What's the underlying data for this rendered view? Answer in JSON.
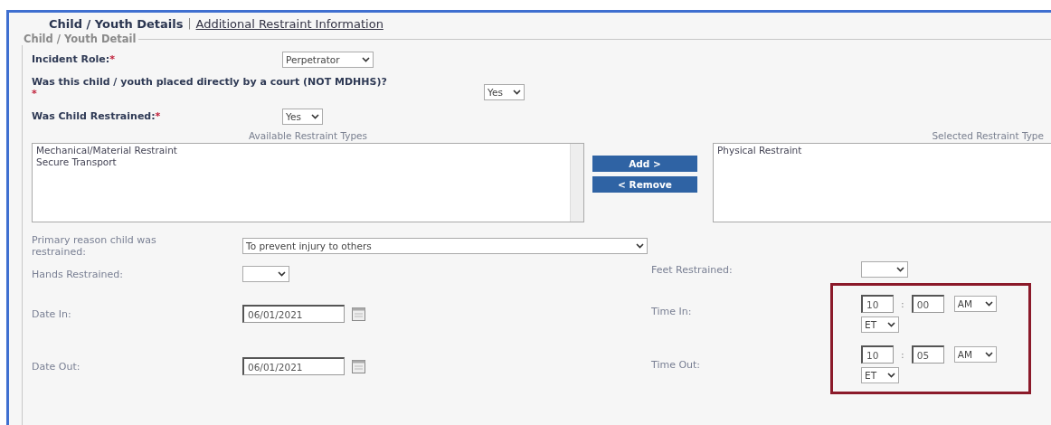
{
  "tabs": [
    {
      "label": "Child / Youth Details",
      "selected": true
    },
    {
      "label": "Additional Restraint Information",
      "selected": false
    }
  ],
  "tab_separator": "|",
  "fieldset": {
    "legend": "Child / Youth Detail",
    "questions": [
      {
        "label": "Incident Role:",
        "required_mark": "*",
        "mark_below": false,
        "value": "Perpetrator"
      },
      {
        "label": "Was this child / youth placed directly by a court (NOT MDHHS)?",
        "required_mark": "*",
        "mark_below": true,
        "value": "Yes"
      },
      {
        "label": "Was Child Restrained:",
        "required_mark": "*",
        "mark_below": false,
        "value": "Yes"
      }
    ],
    "restraints": {
      "available_label": "Available Restraint Types",
      "available": [
        "Mechanical/Material Restraint",
        "Secure Transport"
      ],
      "buttons": [
        "Add >",
        "< Remove"
      ],
      "selected_label": "Selected Restraint Type",
      "selected": [
        "Physical Restraint"
      ]
    },
    "primary_reason": {
      "label": "Primary reason child was restrained:",
      "value": "To prevent injury to others"
    },
    "hands": {
      "label": "Hands Restrained:"
    },
    "feet": {
      "label": "Feet Restrained:"
    },
    "date_in": {
      "label": "Date In:",
      "value": "06/01/2021"
    },
    "date_out": {
      "label": "Date Out:",
      "value": "06/01/2021"
    },
    "time_colon": ":",
    "time_in": {
      "label": "Time In:",
      "hour": "10",
      "minute": "00",
      "period": "AM",
      "zone": "ET"
    },
    "time_out": {
      "label": "Time Out:",
      "hour": "10",
      "minute": "05",
      "period": "AM",
      "zone": "ET"
    }
  }
}
